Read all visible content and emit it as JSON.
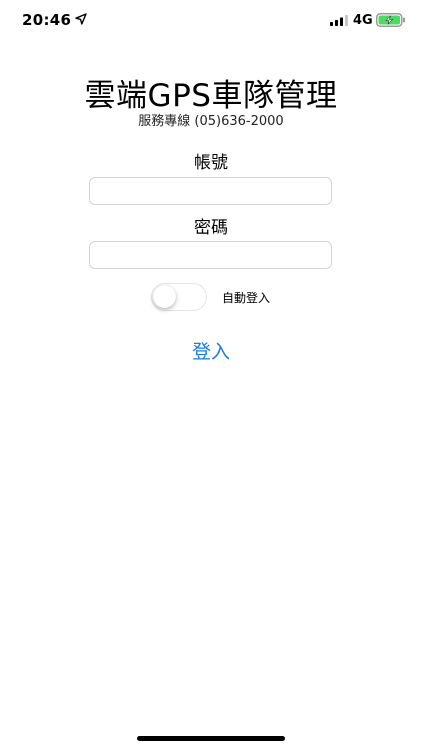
{
  "status_bar": {
    "time": "20:46",
    "network": "4G",
    "icons": {
      "location": "location-arrow-icon",
      "signal": "cellular-signal-icon",
      "battery": "battery-charging-icon"
    },
    "colors": {
      "battery_fill": "#4cd964"
    }
  },
  "header": {
    "title": "雲端GPS車隊管理",
    "service_line": "服務專線 (05)636-2000"
  },
  "form": {
    "account_label": "帳號",
    "account_value": "",
    "password_label": "密碼",
    "password_value": "",
    "auto_login_label": "自動登入",
    "auto_login_on": false,
    "login_button": "登入"
  },
  "colors": {
    "accent": "#1a7be0",
    "input_border": "#d3d3d3"
  }
}
